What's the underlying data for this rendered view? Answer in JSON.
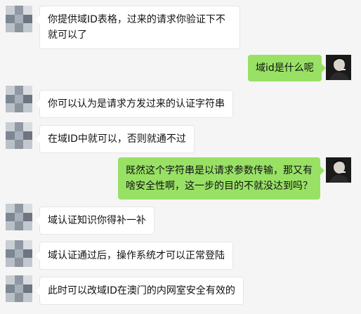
{
  "messages": [
    {
      "side": "left",
      "text": "你提供域ID表格，过来的请求你验证下不就可以了"
    },
    {
      "side": "right",
      "text": "域id是什么呢"
    },
    {
      "side": "left",
      "text": "你可以认为是请求方发过来的认证字符串"
    },
    {
      "side": "left",
      "text": "在域ID中就可以，否则就通不过"
    },
    {
      "side": "right",
      "text": "既然这个字符串是以请求参数传输，那又有啥安全性啊，这一步的目的不就没达到吗？"
    },
    {
      "side": "left",
      "text": "域认证知识你得补一补"
    },
    {
      "side": "left",
      "text": "域认证通过后，操作系统才可以正常登陆"
    },
    {
      "side": "left",
      "text": "此时可以改域ID在澳门的内网室安全有效的"
    }
  ],
  "colors": {
    "background": "#f5f5f5",
    "left_bubble": "#ffffff",
    "right_bubble": "#98e165"
  },
  "icons": {
    "left_avatar": "pixelated-avatar-icon",
    "right_avatar": "user-photo-avatar-icon"
  }
}
